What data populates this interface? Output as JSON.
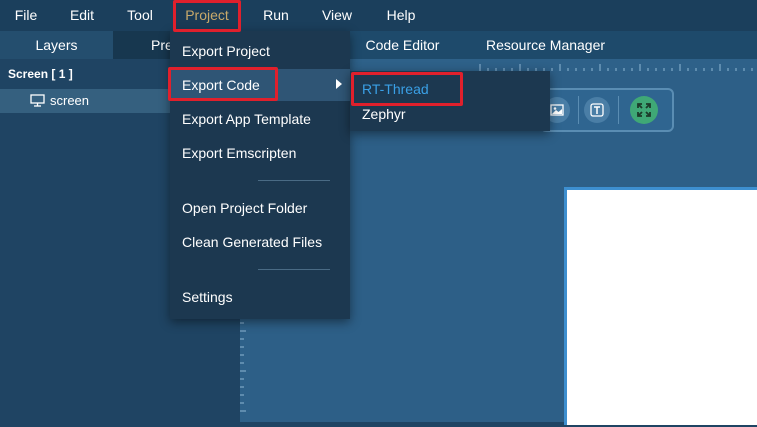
{
  "menubar": {
    "items": [
      "File",
      "Edit",
      "Tool",
      "Project",
      "Run",
      "View",
      "Help"
    ]
  },
  "tabs": {
    "layers": "Layers",
    "preview": "Pre",
    "code_editor": "Code Editor",
    "resource_manager": "Resource Manager"
  },
  "layers": {
    "header": "Screen [ 1 ]",
    "item": "screen"
  },
  "project_menu": {
    "items": [
      "Export Project",
      "Export Code",
      "Export App Template",
      "Export Emscripten",
      "Open Project Folder",
      "Clean Generated Files",
      "Settings"
    ]
  },
  "export_code_submenu": {
    "items": [
      "RT-Thread",
      "Zephyr"
    ]
  },
  "colors": {
    "active_menu": "#c8a96a",
    "highlight_box": "#e0202c",
    "submenu_selected": "#3aa0e6"
  }
}
